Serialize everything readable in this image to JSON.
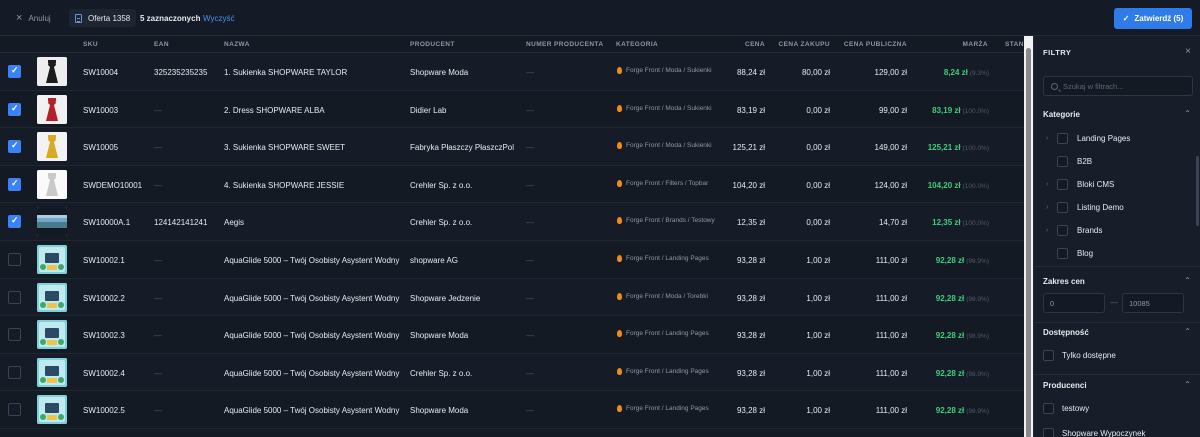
{
  "topbar": {
    "cancel_label": "Anuluj",
    "offer_label": "Oferta 1358",
    "selected_label": "5 zaznaczonych",
    "clear_label": "Wyczyść",
    "confirm_label": "Zatwierdź (5)"
  },
  "table": {
    "headers": {
      "sku": "SKU",
      "ean": "EAN",
      "name": "NAZWA",
      "producer": "PRODUCENT",
      "producer_number": "NUMER PRODUCENTA",
      "category": "KATEGORIA",
      "price": "CENA",
      "purchase_price": "CENA ZAKUPU",
      "public_price": "CENA PUBLICZNA",
      "margin": "MARŻA",
      "stan": "STAN"
    },
    "rows": [
      {
        "checked": true,
        "thumb": "dress-black",
        "sku": "SW10004",
        "ean": "325235235235",
        "name": "1. Sukienka SHOPWARE TAYLOR",
        "producer": "Shopware Moda",
        "producer_number": "—",
        "category": "Forge Front / Moda / Sukienki",
        "price": "88,24 zł",
        "purchase_price": "80,00 zł",
        "public_price": "129,00 zł",
        "margin": "8,24 zł",
        "margin_pct": "(9.3%)"
      },
      {
        "checked": true,
        "thumb": "dress-red",
        "sku": "SW10003",
        "ean": "—",
        "name": "2. Dress SHOPWARE ALBA",
        "producer": "Didier Lab",
        "producer_number": "—",
        "category": "Forge Front / Moda / Sukienki",
        "price": "83,19 zł",
        "purchase_price": "0,00 zł",
        "public_price": "99,00 zł",
        "margin": "83,19 zł",
        "margin_pct": "(100.0%)"
      },
      {
        "checked": true,
        "thumb": "dress-yellow",
        "sku": "SW10005",
        "ean": "—",
        "name": "3. Sukienka SHOPWARE SWEET",
        "producer": "Fabryka Płaszczy PłaszczPol",
        "producer_number": "—",
        "category": "Forge Front / Moda / Sukienki",
        "price": "125,21 zł",
        "purchase_price": "0,00 zł",
        "public_price": "149,00 zł",
        "margin": "125,21 zł",
        "margin_pct": "(100.0%)"
      },
      {
        "checked": true,
        "thumb": "dress-grey",
        "sku": "SWDEMO10001",
        "ean": "—",
        "name": "4. Sukienka SHOPWARE JESSIE",
        "producer": "Crehler Sp. z o.o.",
        "producer_number": "—",
        "category": "Forge Front / Filters / Topbar",
        "price": "104,20 zł",
        "purchase_price": "0,00 zł",
        "public_price": "124,00 zł",
        "margin": "104,20 zł",
        "margin_pct": "(100.0%)"
      },
      {
        "checked": true,
        "thumb": "landscape",
        "sku": "SW10000A.1",
        "ean": "124142141241",
        "name": "Aegis",
        "producer": "Crehler Sp. z o.o.",
        "producer_number": "—",
        "category": "Forge Front / Brands / Testowy",
        "price": "12,35 zł",
        "purchase_price": "0,00 zł",
        "public_price": "14,70 zł",
        "margin": "12,35 zł",
        "margin_pct": "(100.0%)"
      },
      {
        "checked": false,
        "thumb": "aquaglide",
        "sku": "SW10002.1",
        "ean": "—",
        "name": "AquaGlide 5000 – Twój Osobisty Asystent Wodny",
        "producer": "shopware AG",
        "producer_number": "—",
        "category": "Forge Front / Landing Pages",
        "price": "93,28 zł",
        "purchase_price": "1,00 zł",
        "public_price": "111,00 zł",
        "margin": "92,28 zł",
        "margin_pct": "(98.9%)"
      },
      {
        "checked": false,
        "thumb": "aquaglide",
        "sku": "SW10002.2",
        "ean": "—",
        "name": "AquaGlide 5000 – Twój Osobisty Asystent Wodny",
        "producer": "Shopware Jedzenie",
        "producer_number": "—",
        "category": "Forge Front / Moda / Torebki",
        "price": "93,28 zł",
        "purchase_price": "1,00 zł",
        "public_price": "111,00 zł",
        "margin": "92,28 zł",
        "margin_pct": "(98.9%)"
      },
      {
        "checked": false,
        "thumb": "aquaglide",
        "sku": "SW10002.3",
        "ean": "—",
        "name": "AquaGlide 5000 – Twój Osobisty Asystent Wodny",
        "producer": "Shopware Moda",
        "producer_number": "—",
        "category": "Forge Front / Landing Pages",
        "price": "93,28 zł",
        "purchase_price": "1,00 zł",
        "public_price": "111,00 zł",
        "margin": "92,28 zł",
        "margin_pct": "(98.9%)"
      },
      {
        "checked": false,
        "thumb": "aquaglide",
        "sku": "SW10002.4",
        "ean": "—",
        "name": "AquaGlide 5000 – Twój Osobisty Asystent Wodny",
        "producer": "Crehler Sp. z o.o.",
        "producer_number": "—",
        "category": "Forge Front / Landing Pages",
        "price": "93,28 zł",
        "purchase_price": "1,00 zł",
        "public_price": "111,00 zł",
        "margin": "92,28 zł",
        "margin_pct": "(98.9%)"
      },
      {
        "checked": false,
        "thumb": "aquaglide",
        "sku": "SW10002.5",
        "ean": "—",
        "name": "AquaGlide 5000 – Twój Osobisty Asystent Wodny",
        "producer": "Shopware Moda",
        "producer_number": "—",
        "category": "Forge Front / Landing Pages",
        "price": "93,28 zł",
        "purchase_price": "1,00 zł",
        "public_price": "111,00 zł",
        "margin": "92,28 zł",
        "margin_pct": "(98.9%)"
      }
    ]
  },
  "filters": {
    "title": "FILTRY",
    "search_placeholder": "Szukaj w filtrach...",
    "categories_title": "Kategorie",
    "categories": [
      {
        "label": "Landing Pages",
        "expandable": true
      },
      {
        "label": "B2B",
        "expandable": false
      },
      {
        "label": "Bloki CMS",
        "expandable": true
      },
      {
        "label": "Listing Demo",
        "expandable": true
      },
      {
        "label": "Brands",
        "expandable": true
      },
      {
        "label": "Blog",
        "expandable": false
      }
    ],
    "price_title": "Zakres cen",
    "price_min": "0",
    "price_max": "10085",
    "availability_title": "Dostępność",
    "availability_option": "Tylko dostępne",
    "producers_title": "Producenci",
    "producers": [
      "testowy",
      "Shopware Wypoczynek"
    ]
  },
  "colors": {
    "accent": "#2f7be8",
    "margin_positive": "#3ccf7b",
    "category_icon": "#f08a1a"
  }
}
